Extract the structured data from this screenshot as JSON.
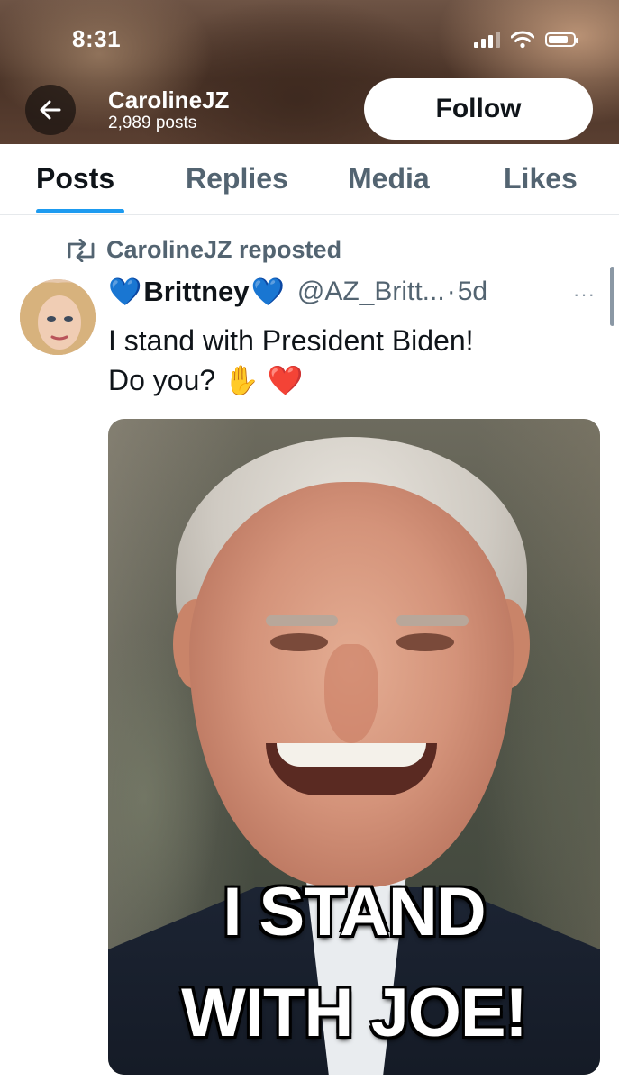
{
  "status_bar": {
    "time": "8:31",
    "battery_level": 0.8
  },
  "header": {
    "profile_name": "CarolineJZ",
    "post_count": "2,989 posts",
    "follow_label": "Follow"
  },
  "tabs": [
    {
      "label": "Posts",
      "active": true
    },
    {
      "label": "Replies",
      "active": false
    },
    {
      "label": "Media",
      "active": false
    },
    {
      "label": "Likes",
      "active": false
    }
  ],
  "post": {
    "repost_label": "CarolineJZ reposted",
    "display_name": "Brittney",
    "name_emoji": "💙",
    "handle": "@AZ_Britt...",
    "separator": "·",
    "time": "5d",
    "more": "···",
    "text_lines": [
      "I stand with President Biden!",
      "Do you? ✋ ❤️"
    ],
    "media": {
      "overlay_line1": "I STAND",
      "overlay_line2": "WITH JOE!"
    }
  },
  "colors": {
    "accent": "#1d9bf0",
    "secondary_text": "#536471",
    "primary_text": "#0f1419"
  }
}
